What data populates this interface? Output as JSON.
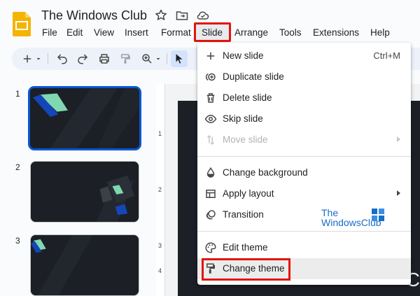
{
  "app": {
    "icon": "slides-logo-icon",
    "accent_color": "#f4b400"
  },
  "document": {
    "title": "The Windows Club"
  },
  "title_icons": [
    "star-icon",
    "move-to-folder-icon",
    "cloud-status-icon"
  ],
  "menubar": {
    "items": [
      "File",
      "Edit",
      "View",
      "Insert",
      "Format",
      "Slide",
      "Arrange",
      "Tools",
      "Extensions",
      "Help"
    ],
    "active": "Slide"
  },
  "toolbar": {
    "icons": [
      "new-slide-plus-icon",
      "dropdown-arrow-icon",
      "undo-icon",
      "redo-icon",
      "print-icon",
      "paint-format-icon",
      "zoom-icon",
      "dropdown-arrow-icon",
      "select-cursor-icon"
    ]
  },
  "filmstrip": {
    "slides": [
      {
        "number": "1",
        "selected": true
      },
      {
        "number": "2",
        "selected": false
      },
      {
        "number": "3",
        "selected": false
      }
    ]
  },
  "ruler": {
    "marks": [
      "1",
      "2",
      "3",
      "4"
    ]
  },
  "canvas": {
    "partial_text": "C"
  },
  "slide_menu": {
    "items": [
      {
        "label": "New slide",
        "icon": "plus-icon",
        "shortcut": "Ctrl+M"
      },
      {
        "label": "Duplicate slide",
        "icon": "duplicate-icon"
      },
      {
        "label": "Delete slide",
        "icon": "trash-icon"
      },
      {
        "label": "Skip slide",
        "icon": "eye-icon"
      },
      {
        "label": "Move slide",
        "icon": "move-arrows-icon",
        "disabled": true,
        "submenu": true
      },
      {
        "label": "Change background",
        "icon": "fill-drop-icon"
      },
      {
        "label": "Apply layout",
        "icon": "layout-icon",
        "submenu": true
      },
      {
        "label": "Transition",
        "icon": "transition-icon"
      },
      {
        "label": "Edit theme",
        "icon": "palette-icon"
      },
      {
        "label": "Change theme",
        "icon": "paint-roller-icon",
        "highlighted": true
      }
    ]
  },
  "watermark": {
    "line1": "The",
    "line2": "WindowsClub"
  },
  "colors": {
    "highlight_red": "#e3140c",
    "selection_blue": "#0b57d0",
    "slide_dark": "#1c1f26",
    "theme_green": "#7fd8b0",
    "theme_blue": "#1446b8"
  }
}
